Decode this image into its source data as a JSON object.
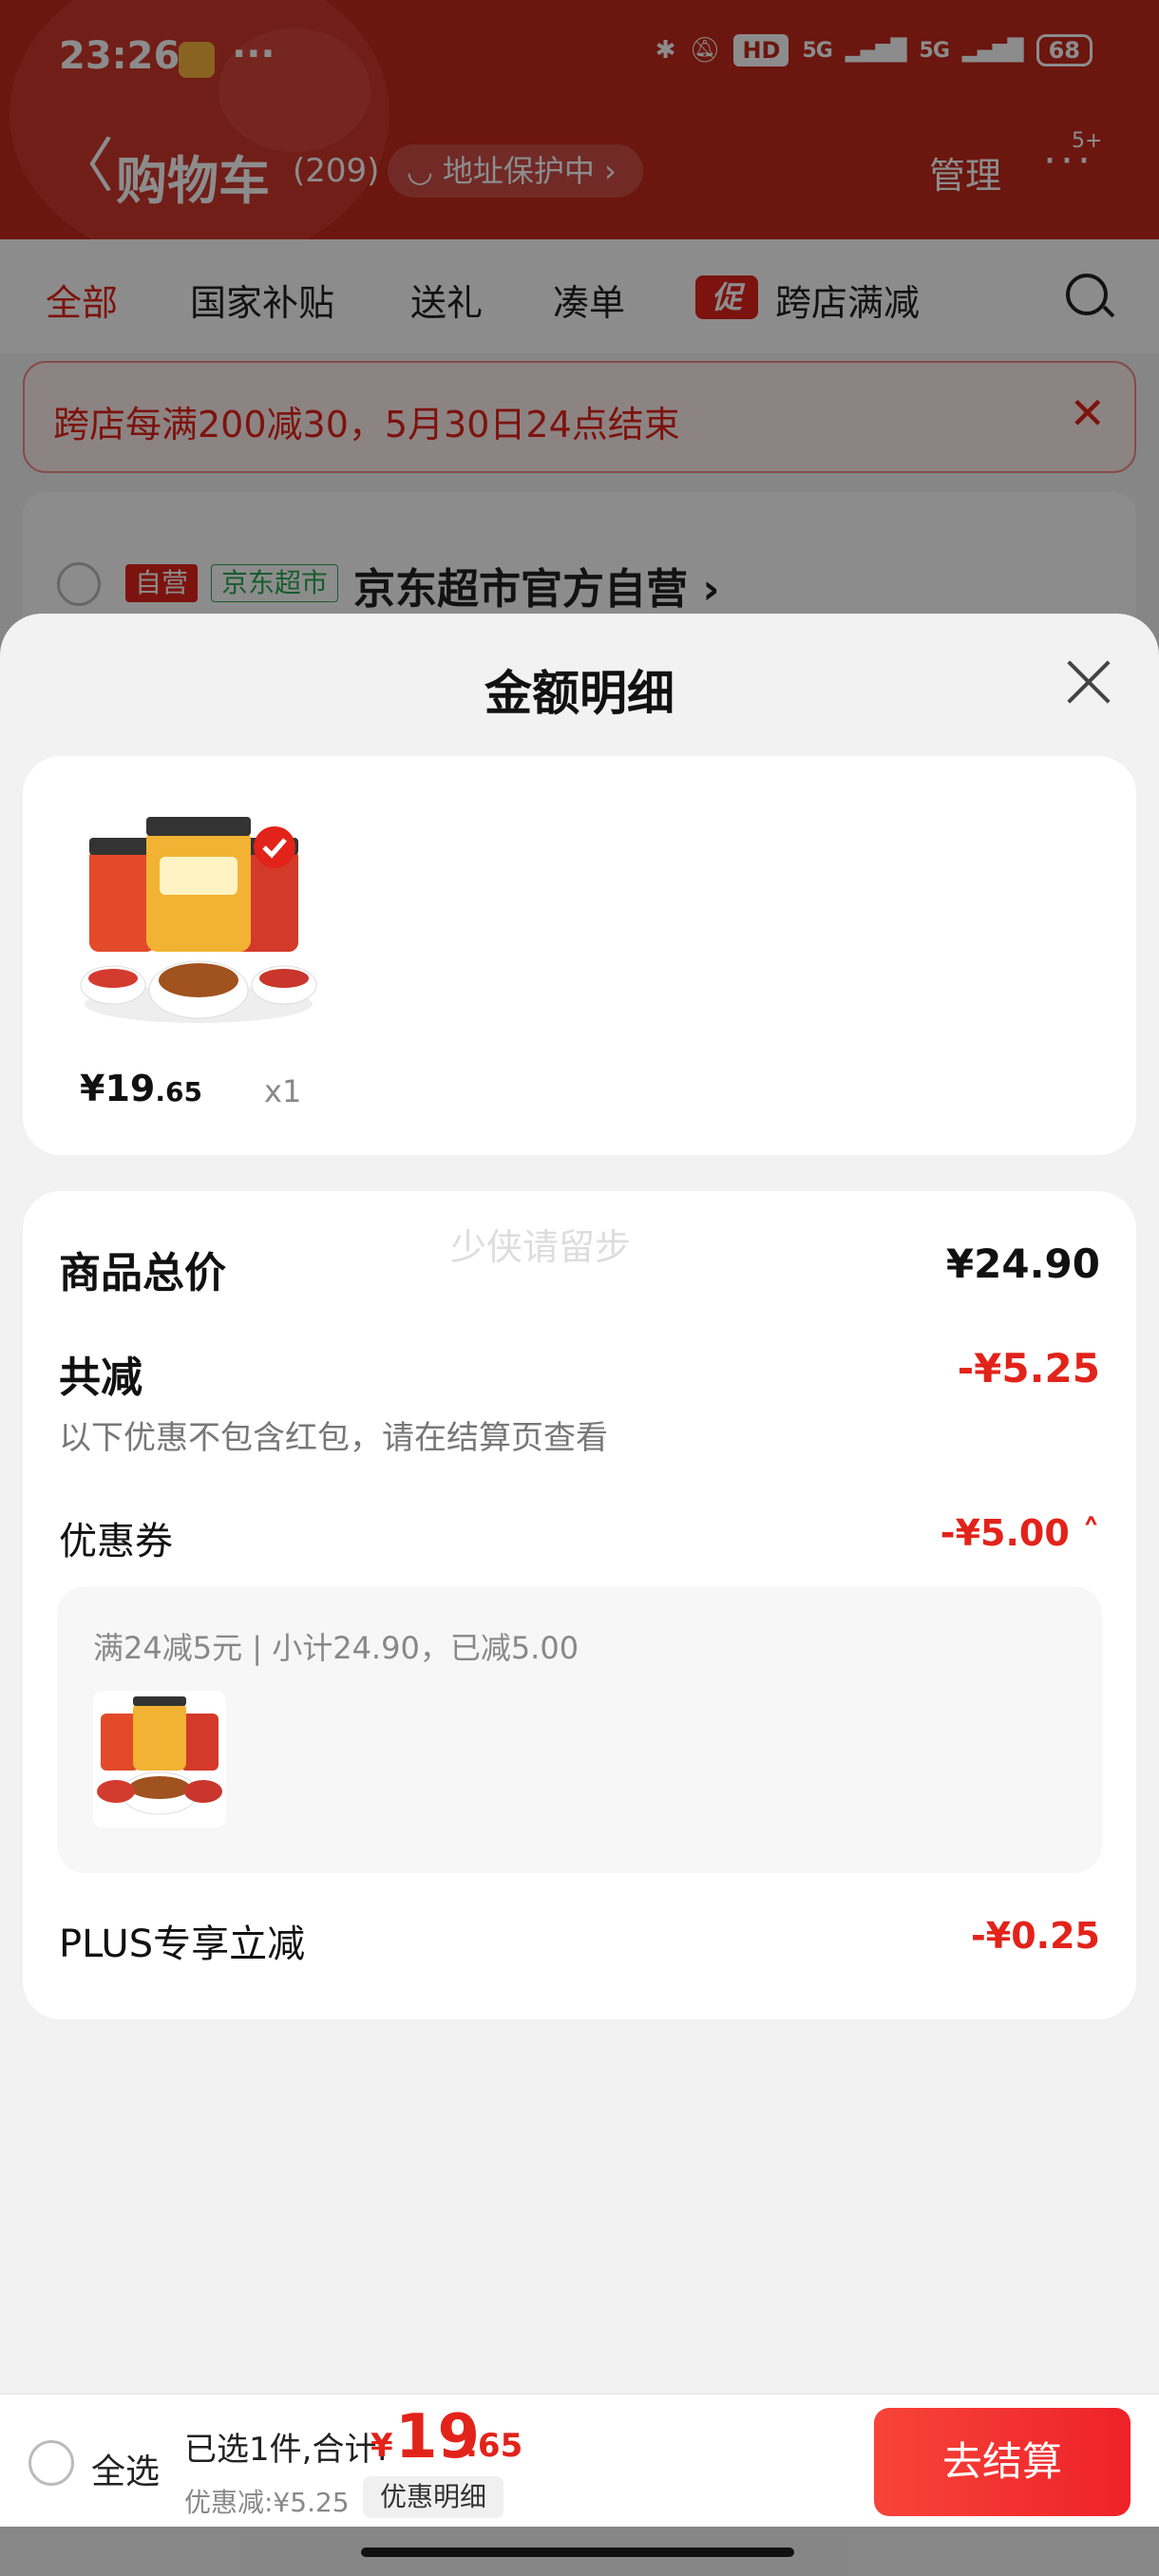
{
  "status_bar": {
    "time": "23:26",
    "dots": "···",
    "hd": "HD",
    "signal1": "5G",
    "signal2": "5G",
    "battery": "68"
  },
  "nav": {
    "back": "〈",
    "title": "购物车",
    "count": "(209)",
    "address": "地址保护中",
    "address_arrow": "›",
    "manage": "管理",
    "more": "···",
    "badge": "5+"
  },
  "tabs": [
    {
      "label": "全部"
    },
    {
      "label": "国家补贴"
    },
    {
      "label": "送礼"
    },
    {
      "label": "凑单"
    },
    {
      "label": "跨店满减",
      "badge": "促"
    }
  ],
  "promo_banner": {
    "text": "跨店每满200减30，5月30日24点结束",
    "close": "✕"
  },
  "shop": {
    "tag_self": "自营",
    "tag_market": "京东超市",
    "name": "京东超市官方自营 ›"
  },
  "sheet": {
    "title": "金额明细",
    "item": {
      "price_int": "¥19",
      "price_dec": ".65",
      "qty": "x1"
    },
    "watermark": "少侠请留步",
    "total_label": "商品总价",
    "total_value": "¥24.90",
    "reduce_label": "共减",
    "reduce_value": "-¥5.25",
    "reduce_note": "以下优惠不包含红包，请在结算页查看",
    "coupon_label": "优惠券",
    "coupon_value": "-¥5.00 ˄",
    "coupon_detail": "满24减5元 | 小计24.90，已减5.00",
    "plus_label": "PLUS专享立减",
    "plus_value": "-¥0.25"
  },
  "bottom_bar": {
    "select_all": "全选",
    "summary": "已选1件,合计:",
    "total_symbol": "¥",
    "total_int": "19",
    "total_dec": ".65",
    "discount": "优惠减:¥5.25",
    "discount_detail": "优惠明细",
    "checkout": "去结算"
  },
  "colors": {
    "brand_red": "#e2231a",
    "header_bg": "#c4281d"
  }
}
